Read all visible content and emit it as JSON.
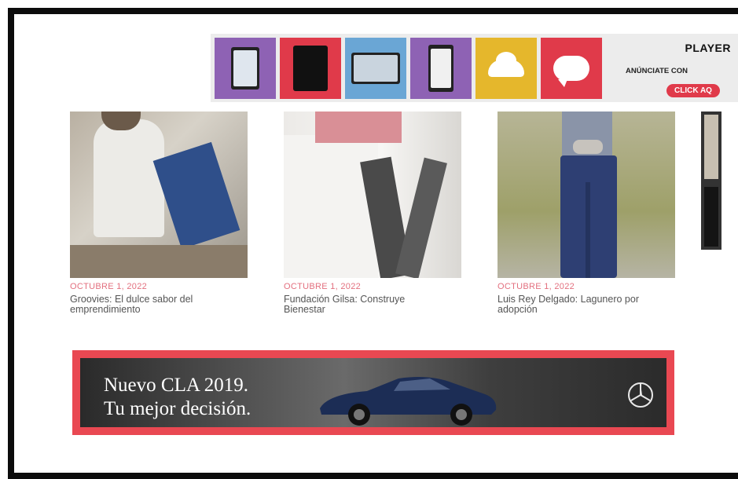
{
  "top_ad": {
    "brand": "PLAYER",
    "line": "ANÚNCIATE CON",
    "cta": "CLICK AQ",
    "tiles": [
      {
        "color": "#8e62b4",
        "icon": "magazine-tablet-icon"
      },
      {
        "color": "#e03a4a",
        "icon": "magazine-cover-icon"
      },
      {
        "color": "#6aa6d5",
        "icon": "website-screen-icon"
      },
      {
        "color": "#8e62b4",
        "icon": "mobile-phone-icon"
      },
      {
        "color": "#e5b72c",
        "icon": "cloud-logo-icon"
      },
      {
        "color": "#e03a4a",
        "icon": "speech-bubble-icon"
      }
    ]
  },
  "articles": [
    {
      "date": "OCTUBRE 1, 2022",
      "title": "Groovies: El dulce sabor del emprendimiento"
    },
    {
      "date": "OCTUBRE 1, 2022",
      "title": "Fundación Gilsa: Construye Bienestar"
    },
    {
      "date": "OCTUBRE 1, 2022",
      "title": "Luis Rey Delgado: Lagunero por adopción"
    }
  ],
  "banner": {
    "line1": "Nuevo CLA 2019.",
    "line2": "Tu mejor decisión."
  },
  "colors": {
    "accent": "#e94852",
    "date_pink": "#e3707f"
  }
}
